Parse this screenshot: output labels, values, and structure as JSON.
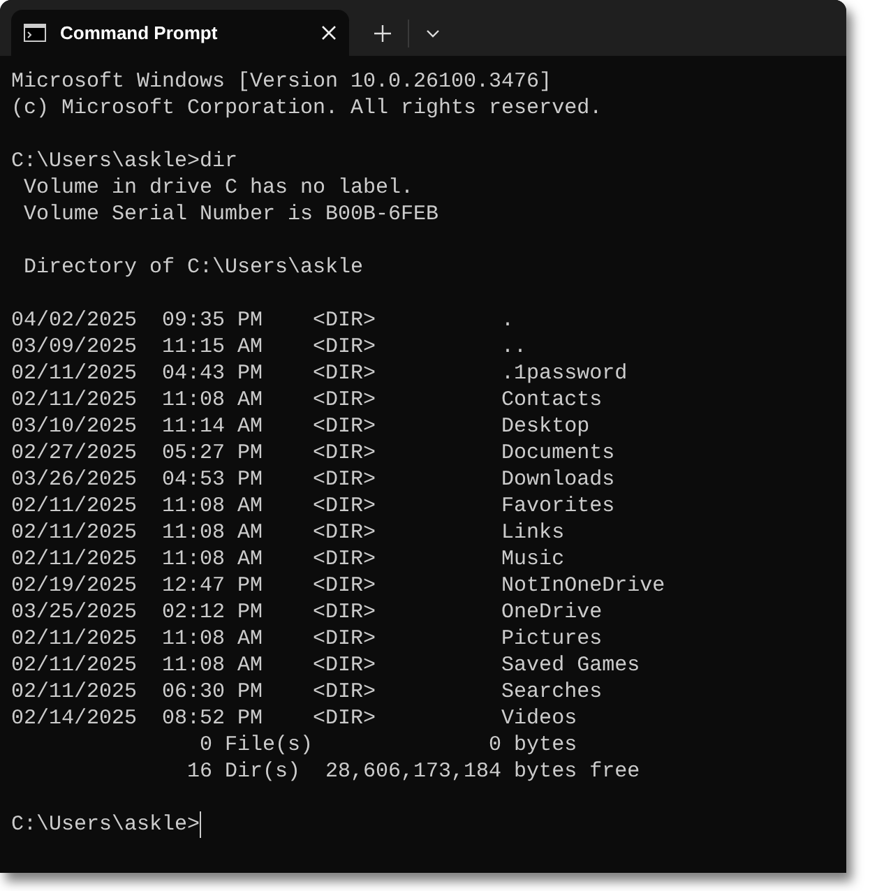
{
  "tab": {
    "title": "Command Prompt",
    "selected": true
  },
  "blocks": [
    [
      "Microsoft Windows [Version 10.0.26100.3476]",
      "(c) Microsoft Corporation. All rights reserved."
    ],
    [
      "C:\\Users\\askle>dir",
      " Volume in drive C has no label.",
      " Volume Serial Number is B00B-6FEB"
    ],
    [
      " Directory of C:\\Users\\askle"
    ],
    [
      "04/02/2025  09:35 PM    <DIR>          .",
      "03/09/2025  11:15 AM    <DIR>          ..",
      "02/11/2025  04:43 PM    <DIR>          .1password",
      "02/11/2025  11:08 AM    <DIR>          Contacts",
      "03/10/2025  11:14 AM    <DIR>          Desktop",
      "02/27/2025  05:27 PM    <DIR>          Documents",
      "03/26/2025  04:53 PM    <DIR>          Downloads",
      "02/11/2025  11:08 AM    <DIR>          Favorites",
      "02/11/2025  11:08 AM    <DIR>          Links",
      "02/11/2025  11:08 AM    <DIR>          Music",
      "02/19/2025  12:47 PM    <DIR>          NotInOneDrive",
      "03/25/2025  02:12 PM    <DIR>          OneDrive",
      "02/11/2025  11:08 AM    <DIR>          Pictures",
      "02/11/2025  11:08 AM    <DIR>          Saved Games",
      "02/11/2025  06:30 PM    <DIR>          Searches",
      "02/14/2025  08:52 PM    <DIR>          Videos",
      "               0 File(s)              0 bytes",
      "              16 Dir(s)  28,606,173,184 bytes free"
    ]
  ],
  "prompt": "C:\\Users\\askle>"
}
